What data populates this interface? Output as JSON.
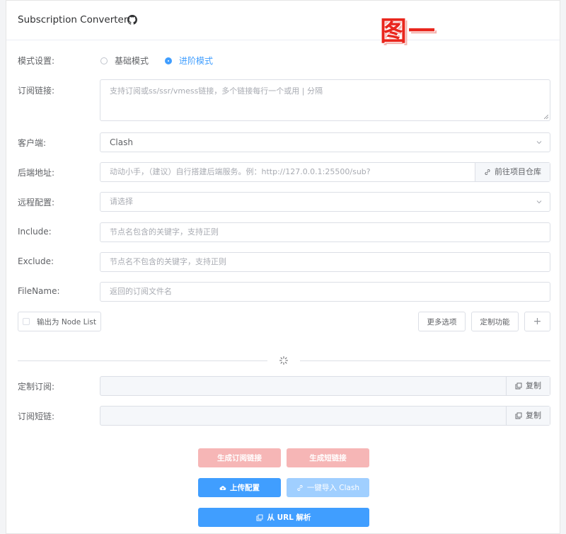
{
  "header": {
    "title": "Subscription Converter",
    "annotation": "图一"
  },
  "mode": {
    "label": "模式设置:",
    "options": [
      {
        "label": "基础模式",
        "selected": false
      },
      {
        "label": "进阶模式",
        "selected": true
      }
    ]
  },
  "subscription": {
    "label": "订阅链接:",
    "placeholder": "支持订阅或ss/ssr/vmess链接，多个链接每行一个或用 | 分隔"
  },
  "client": {
    "label": "客户端:",
    "value": "Clash"
  },
  "backend": {
    "label": "后端地址:",
    "placeholder": "动动小手，（建议）自行搭建后端服务。例：http://127.0.0.1:25500/sub?",
    "append_label": "前往项目仓库"
  },
  "remote_config": {
    "label": "远程配置:",
    "placeholder": "请选择"
  },
  "include": {
    "label": "Include:",
    "placeholder": "节点名包含的关键字，支持正则"
  },
  "exclude": {
    "label": "Exclude:",
    "placeholder": "节点名不包含的关键字，支持正则"
  },
  "filename": {
    "label": "FileName:",
    "placeholder": "返回的订阅文件名"
  },
  "options_row": {
    "node_list_label": "输出为 Node List",
    "more_options": "更多选项",
    "custom_features": "定制功能",
    "plus": "+"
  },
  "custom_sub": {
    "label": "定制订阅:",
    "copy_label": "复制"
  },
  "short_link": {
    "label": "订阅短链:",
    "copy_label": "复制"
  },
  "actions": {
    "gen_sub": "生成订阅链接",
    "gen_short": "生成短链接",
    "upload": "上传配置",
    "import_clash": "一键导入 Clash",
    "parse_url": "从 URL 解析"
  },
  "colors": {
    "primary": "#409eff",
    "primary_light": "#a0cfff",
    "danger_light": "#f6b6b6",
    "annotation_red": "#e9261d"
  }
}
